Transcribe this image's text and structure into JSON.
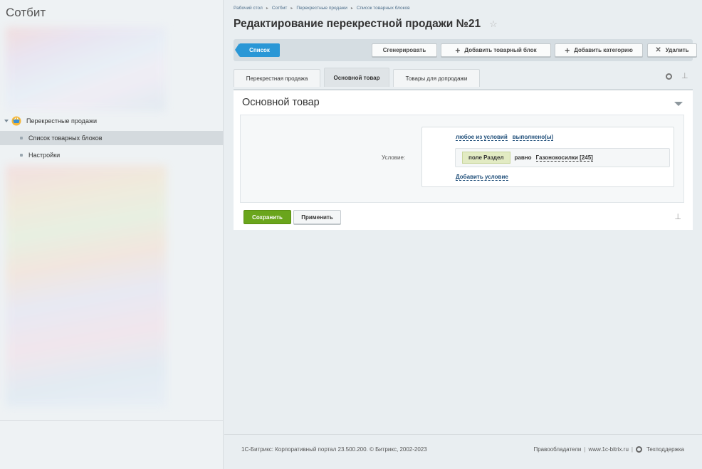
{
  "app": {
    "title": "Сотбит"
  },
  "sidebar": {
    "root_label": "Перекрестные продажи",
    "items": [
      {
        "label": "Список товарных блоков",
        "active": true
      },
      {
        "label": "Настройки",
        "active": false
      }
    ]
  },
  "breadcrumb": [
    "Рабочий стол",
    "Сотбит",
    "Перекрестные продажи",
    "Список товарных блоков"
  ],
  "page": {
    "title": "Редактирование перекрестной продажи №21"
  },
  "toolbar": {
    "list_label": "Список",
    "generate_label": "Сгенерировать",
    "add_block_label": "Добавить товарный блок",
    "add_category_label": "Добавить категорию",
    "delete_label": "Удалить"
  },
  "tabs": [
    {
      "label": "Перекрестная продажа",
      "active": false
    },
    {
      "label": "Основной товар",
      "active": true
    },
    {
      "label": "Товары для допродажи",
      "active": false
    }
  ],
  "panel": {
    "title": "Основной товар",
    "condition_label": "Условие:",
    "any_label": "любое из условий",
    "fulfilled_label": "выполнено(ы)",
    "field_tag": "поле Раздел",
    "operator": "равно",
    "value": "Газонокосилки [245]",
    "add_condition_label": "Добавить условие"
  },
  "actions": {
    "save_label": "Сохранить",
    "apply_label": "Применить"
  },
  "footer": {
    "copyright": "1С-Битрикс: Корпоративный портал 23.500.200. © Битрикс, 2002-2023",
    "rights_label": "Правообладатели",
    "site_label": "www.1c-bitrix.ru",
    "support_label": "Техподдержка"
  },
  "colors": {
    "accent": "#2a97d6",
    "save": "#6aa51c",
    "link": "#1f4e79"
  }
}
